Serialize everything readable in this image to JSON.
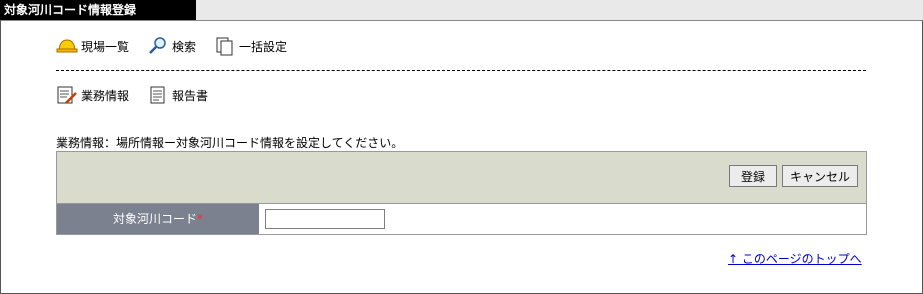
{
  "window": {
    "title": "対象河川コード情報登録"
  },
  "toolbar_primary": [
    {
      "label": "現場一覧",
      "icon": "hardhat-icon"
    },
    {
      "label": "検索",
      "icon": "magnifier-icon"
    },
    {
      "label": "一括設定",
      "icon": "documents-icon"
    }
  ],
  "toolbar_secondary": [
    {
      "label": "業務情報",
      "icon": "edit-document-icon"
    },
    {
      "label": "報告書",
      "icon": "report-icon"
    }
  ],
  "description": "業務情報：場所情報ー対象河川コード情報を設定してください。",
  "buttons": {
    "register": "登録",
    "cancel": "キャンセル"
  },
  "form": {
    "field_label": "対象河川コード",
    "required_mark": "*",
    "field_value": ""
  },
  "footer": {
    "top_link": "↑ このページのトップへ"
  },
  "colors": {
    "accent_link": "#0000cc",
    "label_bg": "#7b818e",
    "button_bar_bg": "#d9dccd",
    "required": "#ff2a2a"
  }
}
